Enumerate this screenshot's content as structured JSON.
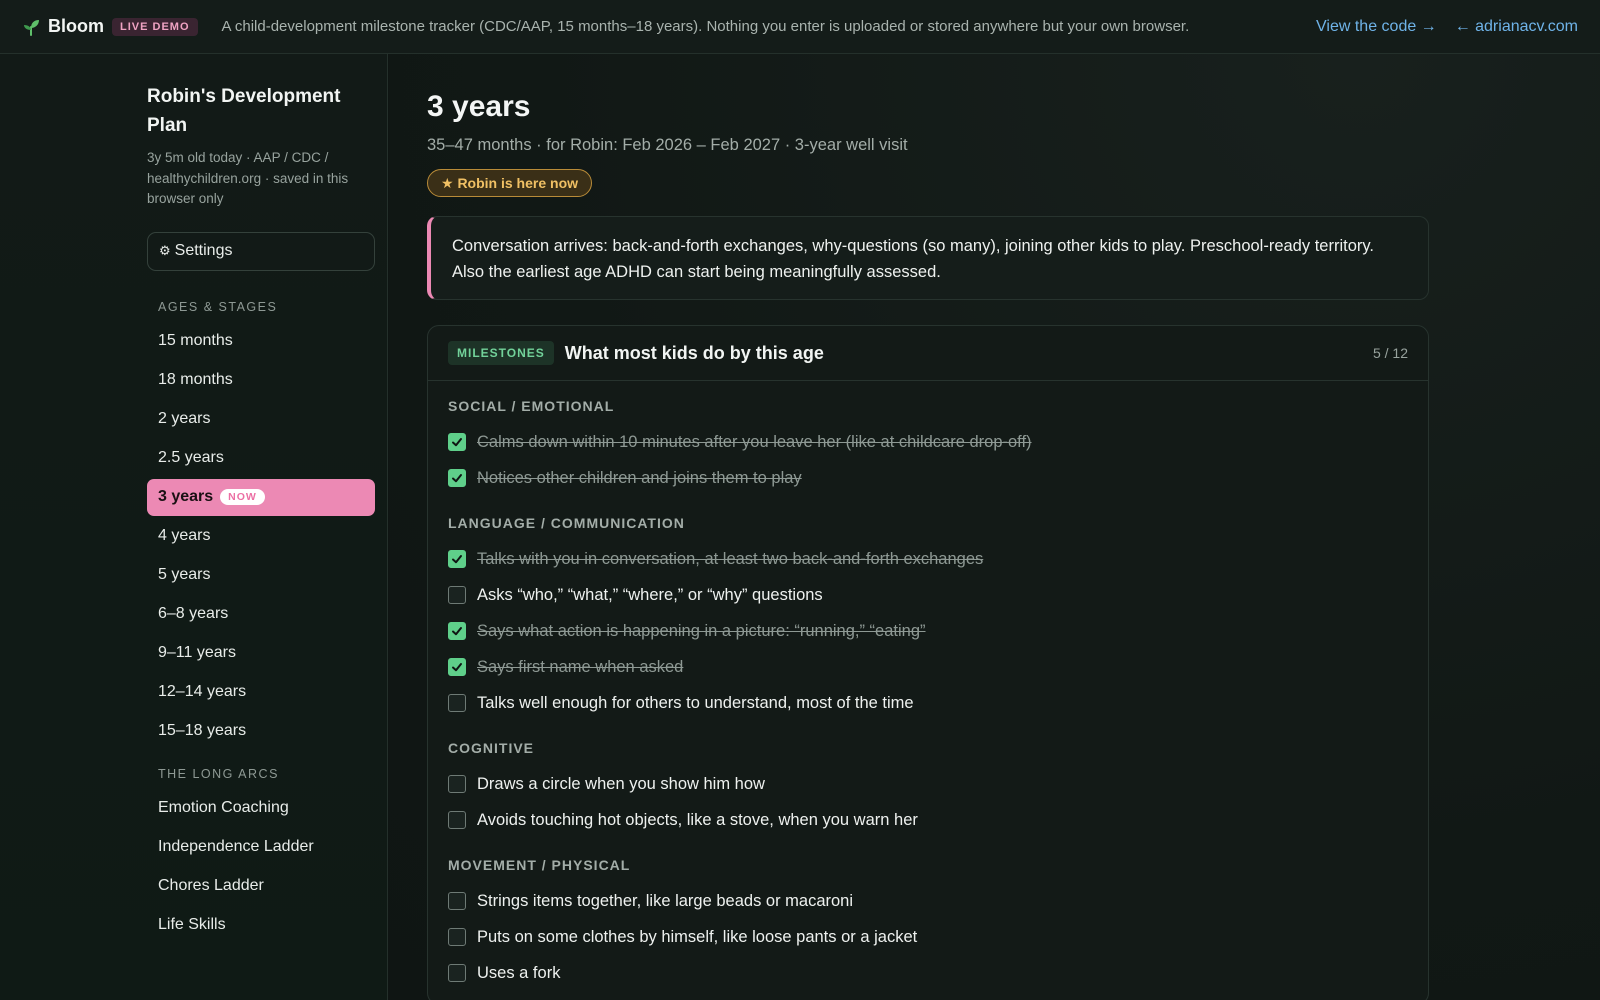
{
  "topbar": {
    "brand": "Bloom",
    "badge": "LIVE DEMO",
    "tagline": "A child-development milestone tracker (CDC/AAP, 15 months–18 years). Nothing you enter is uploaded or stored anywhere but your own browser.",
    "view_code": "View the code →",
    "site_link": "← adrianacv.com"
  },
  "sidebar": {
    "plan_title": "Robin's Development Plan",
    "plan_sub": "3y 5m old today · AAP / CDC / healthychildren.org · saved in this browser only",
    "settings_icon": "⚙",
    "settings_label": "Settings",
    "ages_label": "AGES & STAGES",
    "ages": [
      {
        "label": "15 months"
      },
      {
        "label": "18 months"
      },
      {
        "label": "2 years"
      },
      {
        "label": "2.5 years"
      },
      {
        "label": "3 years",
        "tag": "NOW"
      },
      {
        "label": "4 years"
      },
      {
        "label": "5 years"
      },
      {
        "label": "6–8 years"
      },
      {
        "label": "9–11 years"
      },
      {
        "label": "12–14 years"
      },
      {
        "label": "15–18 years"
      }
    ],
    "arcs_label": "THE LONG ARCS",
    "arcs": [
      {
        "label": "Emotion Coaching"
      },
      {
        "label": "Independence Ladder"
      },
      {
        "label": "Chores Ladder"
      },
      {
        "label": "Life Skills"
      }
    ]
  },
  "main": {
    "title": "3 years",
    "subtitle": "35–47 months · for Robin: Feb 2026 – Feb 2027 · 3-year well visit",
    "here_pill": "★ Robin is here now",
    "intro": "Conversation arrives: back-and-forth exchanges, why-questions (so many), joining other kids to play. Preschool-ready territory. Also the earliest age ADHD can start being meaningfully assessed.",
    "card": {
      "badge": "MILESTONES",
      "title": "What most kids do by this age",
      "count": "5 / 12",
      "categories": [
        {
          "label": "SOCIAL / EMOTIONAL",
          "items": [
            {
              "text": "Calms down within 10 minutes after you leave her (like at childcare drop-off)",
              "checked": true
            },
            {
              "text": "Notices other children and joins them to play",
              "checked": true
            }
          ]
        },
        {
          "label": "LANGUAGE / COMMUNICATION",
          "items": [
            {
              "text": "Talks with you in conversation, at least two back-and-forth exchanges",
              "checked": true
            },
            {
              "text": "Asks “who,” “what,” “where,” or “why” questions",
              "checked": false
            },
            {
              "text": "Says what action is happening in a picture: “running,” “eating”",
              "checked": true
            },
            {
              "text": "Says first name when asked",
              "checked": true
            },
            {
              "text": "Talks well enough for others to understand, most of the time",
              "checked": false
            }
          ]
        },
        {
          "label": "COGNITIVE",
          "items": [
            {
              "text": "Draws a circle when you show him how",
              "checked": false
            },
            {
              "text": "Avoids touching hot objects, like a stove, when you warn her",
              "checked": false
            }
          ]
        },
        {
          "label": "MOVEMENT / PHYSICAL",
          "items": [
            {
              "text": "Strings items together, like large beads or macaroni",
              "checked": false
            },
            {
              "text": "Puts on some clothes by himself, like loose pants or a jacket",
              "checked": false
            },
            {
              "text": "Uses a fork",
              "checked": false
            }
          ]
        }
      ]
    }
  }
}
